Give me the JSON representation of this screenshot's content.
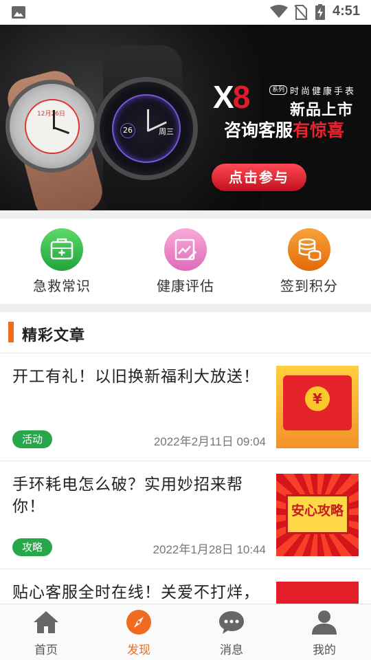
{
  "status_bar": {
    "time": "4:51",
    "icons": [
      "image-notification-icon",
      "wifi-icon",
      "no-sim-icon",
      "battery-charging-icon"
    ]
  },
  "banner": {
    "promo_model": "X8",
    "promo_series": "系列",
    "promo_brand": "时尚健康手表",
    "promo_new": "新品上市",
    "promo_ask_prefix": "咨询客服",
    "promo_ask_highlight": "有惊喜",
    "promo_cta": "点击参与",
    "watch_date": "12月26日",
    "watch_day": "周三",
    "watch_num": "26",
    "pager_count": 3,
    "pager_active": 1
  },
  "quick_actions": [
    {
      "label": "急救常识",
      "icon": "first-aid-kit-icon",
      "color": "#27b34a"
    },
    {
      "label": "健康评估",
      "icon": "chart-edit-icon",
      "color": "#e880c6"
    },
    {
      "label": "签到积分",
      "icon": "coins-database-icon",
      "color": "#ee7d14"
    }
  ],
  "section": {
    "title": "精彩文章"
  },
  "articles": [
    {
      "title": "开工有礼！以旧换新福利大放送！",
      "tag": "活动",
      "date": "2022年2月11日 09:04",
      "thumb_text": "¥"
    },
    {
      "title": "手环耗电怎么破？实用妙招来帮你！",
      "tag": "攻略",
      "date": "2022年1月28日 10:44",
      "thumb_text": "安心攻略"
    },
    {
      "title": "贴心客服全时在线！关爱不打烊，",
      "tag": "",
      "date": "",
      "thumb_text": ""
    }
  ],
  "bottom_nav": [
    {
      "label": "首页",
      "icon": "home-icon",
      "active": false
    },
    {
      "label": "发现",
      "icon": "compass-icon",
      "active": true
    },
    {
      "label": "消息",
      "icon": "chat-bubble-icon",
      "active": false
    },
    {
      "label": "我的",
      "icon": "user-icon",
      "active": false
    }
  ],
  "colors": {
    "accent": "#f06a22",
    "tag_green": "#27a74a",
    "banner_red": "#e01b2b"
  }
}
